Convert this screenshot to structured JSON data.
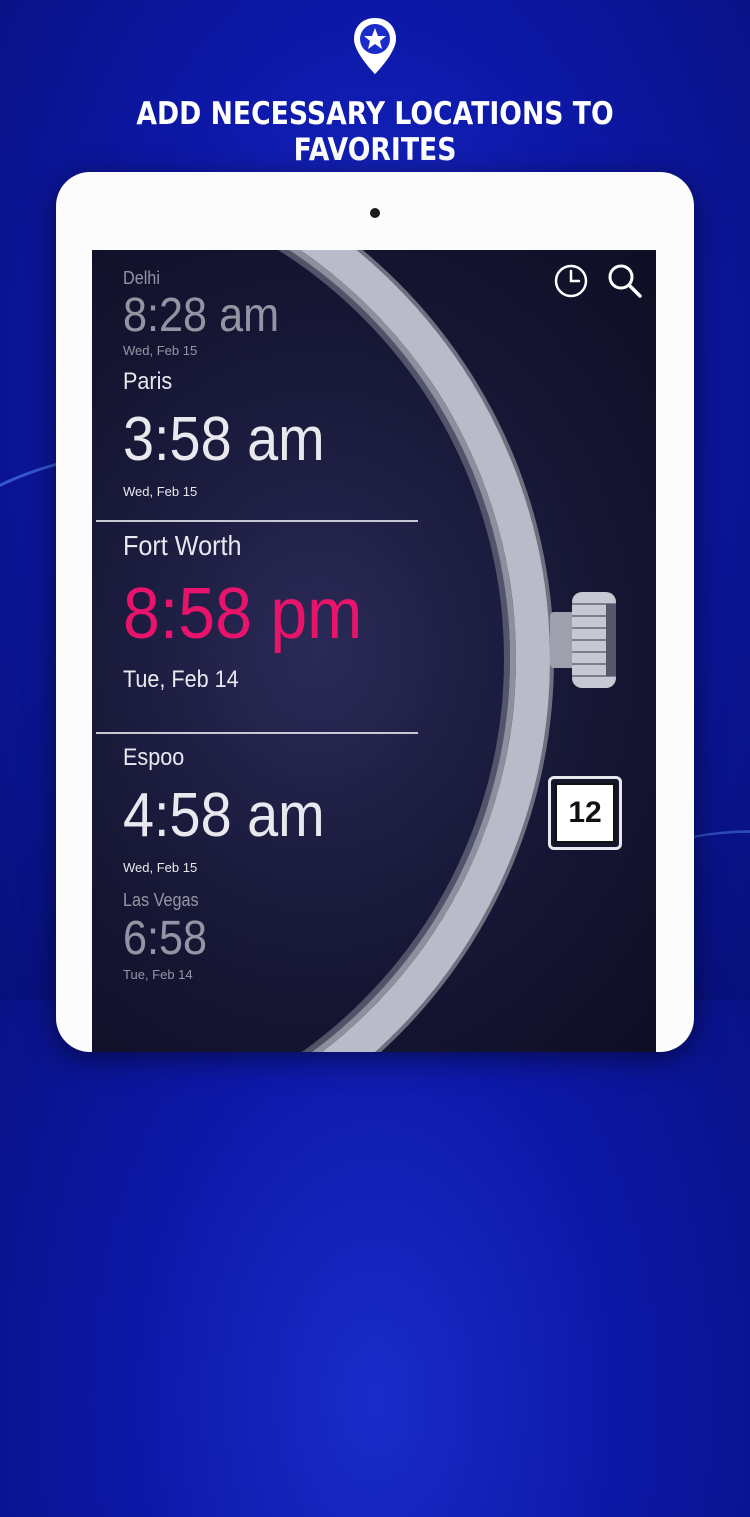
{
  "header": {
    "headline": "ADD NECESSARY LOCATIONS TO FAVORITES",
    "icon": "star-location-pin-icon"
  },
  "toolbar": {
    "icons": [
      "clock-icon",
      "search-icon"
    ]
  },
  "locations": [
    {
      "city": "Delhi",
      "time": "8:28 am",
      "date": "Wed, Feb 15"
    },
    {
      "city": "Paris",
      "time": "3:58 am",
      "date": "Wed, Feb 15"
    },
    {
      "city": "Fort Worth",
      "time": "8:58 pm",
      "date": "Tue, Feb 14"
    },
    {
      "city": "Espoo",
      "time": "4:58 am",
      "date": "Wed, Feb 15"
    },
    {
      "city": "Las Vegas",
      "time": "6:58",
      "date": "Tue, Feb 14"
    }
  ],
  "format_badge": "12",
  "colors": {
    "background": "#0d18a8",
    "highlight_time": "#e8136b",
    "text": "#e8e8ee"
  }
}
